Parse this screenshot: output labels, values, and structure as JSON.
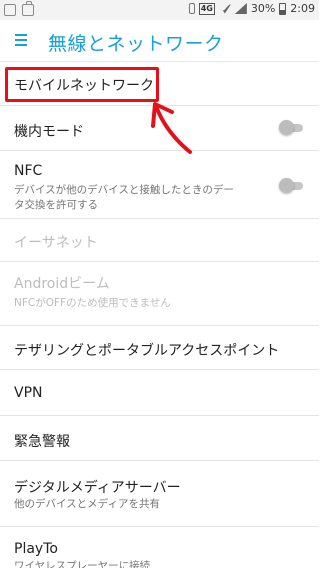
{
  "status_bar": {
    "network_badge": "4G",
    "battery": "30%",
    "time": "2:09"
  },
  "app_bar": {
    "title": "無線とネットワーク",
    "menu_icon": "hamburger-menu-icon"
  },
  "items": [
    {
      "title": "モバイルネットワーク"
    },
    {
      "title": "機内モード",
      "toggle": "off"
    },
    {
      "title": "NFC",
      "subtitle_lines": [
        "デバイスが他のデバイスと接触したときのデー",
        "タ交換を許可する"
      ],
      "toggle": "off"
    },
    {
      "title": "イーサネット",
      "disabled": true
    },
    {
      "title": "Androidビーム",
      "subtitle": "NFCがOFFのため使用できません",
      "disabled": true
    },
    {
      "title": "テザリングとポータブルアクセスポイント"
    },
    {
      "title": "VPN"
    },
    {
      "title": "緊急警報"
    },
    {
      "title": "デジタルメディアサーバー",
      "subtitle": "他のデバイスとメディアを共有"
    },
    {
      "title": "PlayTo",
      "subtitle": "ワイヤレスプレーヤーに接続"
    }
  ],
  "colors": {
    "accent": "#1aa0d8",
    "annotation": "#e5111a"
  }
}
